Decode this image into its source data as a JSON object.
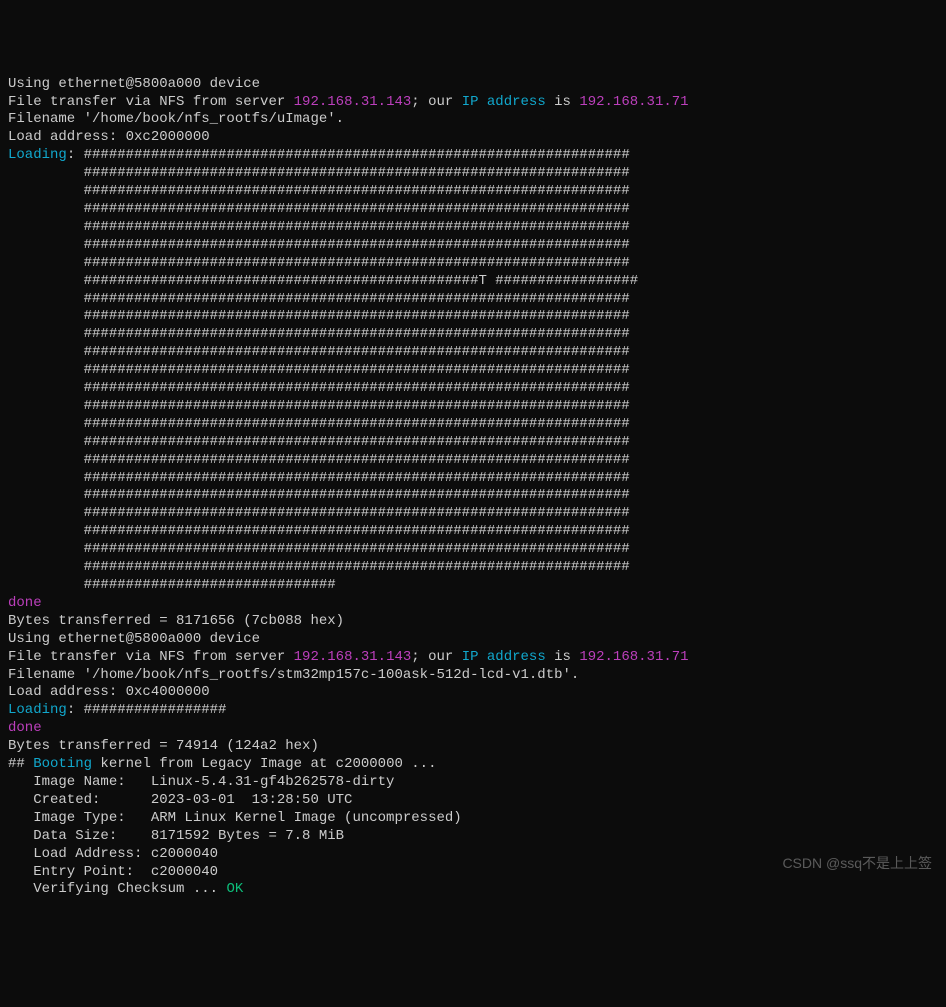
{
  "line1": "Using ethernet@5800a000 device",
  "nfs1": {
    "prefix": "File transfer via NFS from server ",
    "server_ip": "192.168.31.143",
    "sep": "; our ",
    "ip_label": "IP address",
    "mid": " is ",
    "client_ip": "192.168.31.71"
  },
  "filename1": "Filename '/home/book/nfs_rootfs/uImage'.",
  "loadaddr1": "Load address: 0xc2000000",
  "loading_label": "Loading",
  "colon_space": ": ",
  "hashes": [
    "#################################################################",
    "         #################################################################",
    "         #################################################################",
    "         #################################################################",
    "         #################################################################",
    "         #################################################################",
    "         #################################################################",
    "         ###############################################T #################",
    "         #################################################################",
    "         #################################################################",
    "         #################################################################",
    "         #################################################################",
    "         #################################################################",
    "         #################################################################",
    "         #################################################################",
    "         #################################################################",
    "         #################################################################",
    "         #################################################################",
    "         #################################################################",
    "         #################################################################",
    "         #################################################################",
    "         #################################################################",
    "         #################################################################",
    "         #################################################################",
    "         ##############################"
  ],
  "done": "done",
  "bytes1": "Bytes transferred = 8171656 (7cb088 hex)",
  "line_eth2": "Using ethernet@5800a000 device",
  "nfs2": {
    "prefix": "File transfer via NFS from server ",
    "server_ip": "192.168.31.143",
    "sep": "; our ",
    "ip_label": "IP address",
    "mid": " is ",
    "client_ip": "192.168.31.71"
  },
  "filename2": "Filename '/home/book/nfs_rootfs/stm32mp157c-100ask-512d-lcd-v1.dtb'.",
  "loadaddr2": "Load address: 0xc4000000",
  "hashes2": "#################",
  "bytes2": "Bytes transferred = 74914 (124a2 hex)",
  "boot": {
    "prefix": "## ",
    "word": "Booting",
    "rest": " kernel from Legacy Image at c2000000 ..."
  },
  "image_name": "   Image Name:   Linux-5.4.31-gf4b262578-dirty",
  "created": "   Created:      2023-03-01  13:28:50 UTC",
  "image_type": "   Image Type:   ARM Linux Kernel Image (uncompressed)",
  "data_size": "   Data Size:    8171592 Bytes = 7.8 MiB",
  "load_address": "   Load Address: c2000040",
  "entry_point": "   Entry Point:  c2000040",
  "verify_prefix": "   Verifying Checksum ... ",
  "verify_ok": "OK",
  "watermark": "CSDN @ssq不是上上签"
}
